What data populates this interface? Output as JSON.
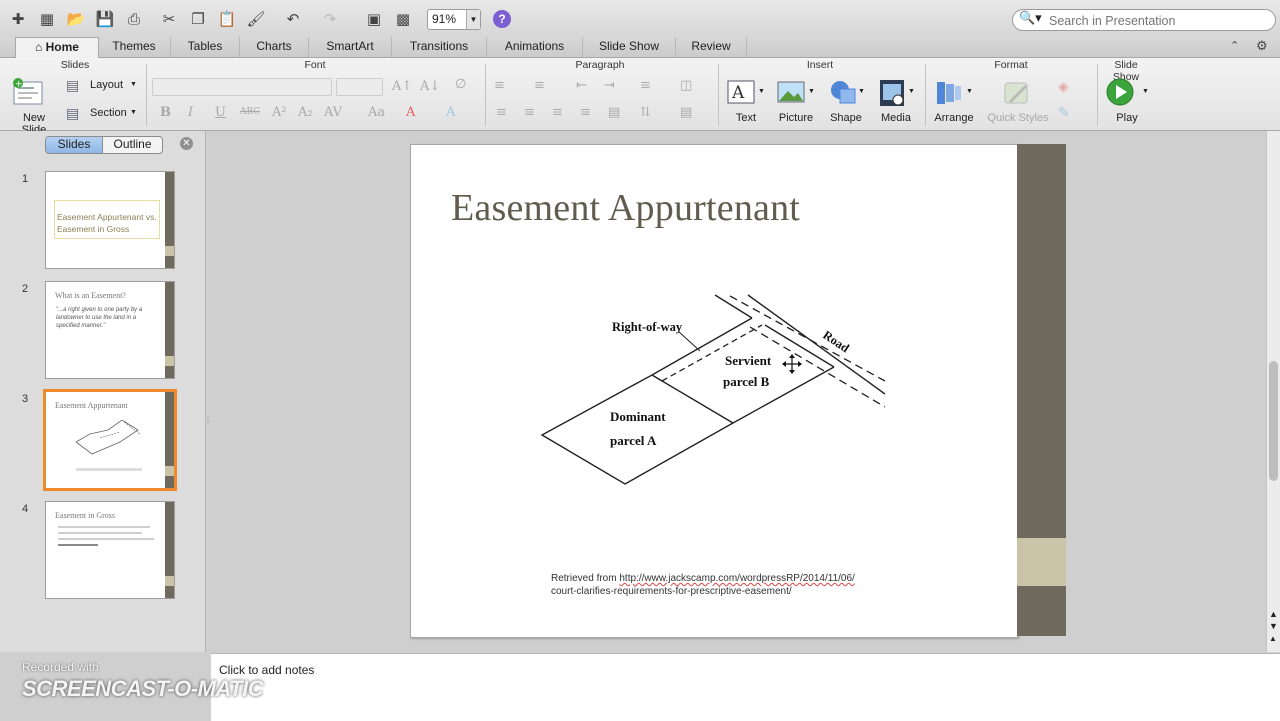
{
  "toolbar": {
    "zoom": "91%",
    "search_placeholder": "Search in Presentation",
    "help_label": "?"
  },
  "tabs": [
    "Home",
    "Themes",
    "Tables",
    "Charts",
    "SmartArt",
    "Transitions",
    "Animations",
    "Slide Show",
    "Review"
  ],
  "ribbon": {
    "groups": {
      "slides": "Slides",
      "font": "Font",
      "paragraph": "Paragraph",
      "insert": "Insert",
      "format": "Format",
      "slideshow": "Slide Show"
    },
    "new_slide": "New Slide",
    "layout": "Layout",
    "section": "Section",
    "text": "Text",
    "picture": "Picture",
    "shape": "Shape",
    "media": "Media",
    "arrange": "Arrange",
    "quick_styles": "Quick Styles",
    "play": "Play"
  },
  "left_pane": {
    "tab_slides": "Slides",
    "tab_outline": "Outline",
    "slides": [
      {
        "num": "1",
        "title": "Easement Appurtenant vs. Easement in Gross"
      },
      {
        "num": "2",
        "title": "What is an Easement?",
        "body": "\"...a right given to one party by a landowner to use the land in a specified manner.\""
      },
      {
        "num": "3",
        "title": "Easement Appurtenant"
      },
      {
        "num": "4",
        "title": "Easement in Gross"
      }
    ]
  },
  "slide": {
    "title": "Easement Appurtenant",
    "diagram": {
      "right_of_way": "Right-of-way",
      "servient": "Servient",
      "parcel_b": "parcel B",
      "dominant": "Dominant",
      "parcel_a": "parcel A",
      "road": "Road"
    },
    "caption_line1_prefix": "Retrieved from ",
    "caption_line1_link": "http://www.jackscamp.com/wordpressRP/2014/11/06/",
    "caption_line2": "court-clarifies-requirements-for-prescriptive-easement/"
  },
  "notes": {
    "placeholder": "Click to add notes"
  },
  "watermark": {
    "line1": "Recorded with",
    "line2": "SCREENCAST-O-MATIC"
  },
  "colors": {
    "accent_orange": "#ee8a2b",
    "slide_bar": "#6e6a5e",
    "slide_bar_light": "#cbc4a8",
    "title_color": "#625c4f"
  }
}
